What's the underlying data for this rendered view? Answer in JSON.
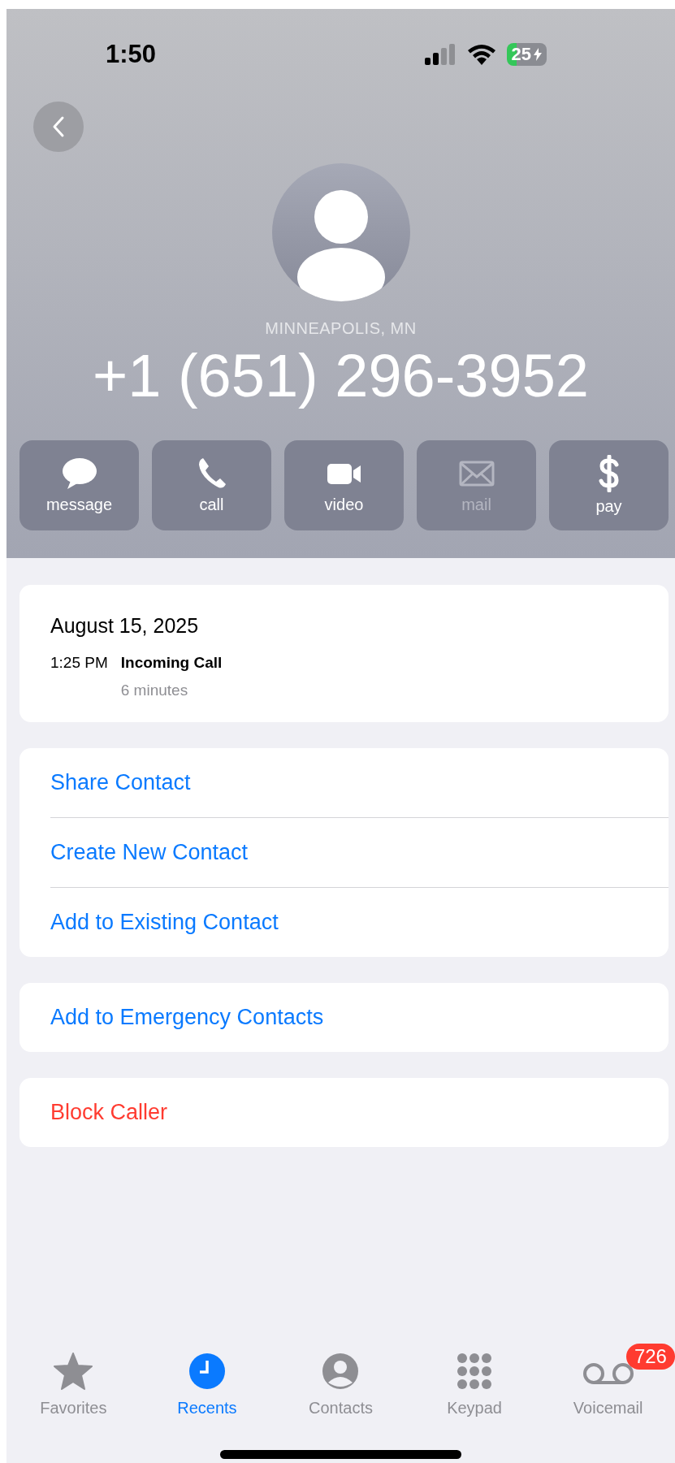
{
  "status_bar": {
    "time": "1:50",
    "battery": "25"
  },
  "header": {
    "location": "MINNEAPOLIS, MN",
    "number": "+1 (651) 296-3952"
  },
  "actions": [
    {
      "label": "message",
      "kind": "message",
      "disabled": false
    },
    {
      "label": "call",
      "kind": "call",
      "disabled": false
    },
    {
      "label": "video",
      "kind": "video",
      "disabled": false
    },
    {
      "label": "mail",
      "kind": "mail",
      "disabled": true
    },
    {
      "label": "pay",
      "kind": "pay",
      "disabled": false
    }
  ],
  "call_log": {
    "date": "August 15, 2025",
    "entries": [
      {
        "time": "1:25 PM",
        "type": "Incoming Call",
        "duration": "6 minutes"
      }
    ]
  },
  "groups": [
    {
      "items": [
        {
          "label": "Share Contact",
          "kind": "normal"
        },
        {
          "label": "Create New Contact",
          "kind": "normal"
        },
        {
          "label": "Add to Existing Contact",
          "kind": "normal"
        }
      ]
    },
    {
      "items": [
        {
          "label": "Add to Emergency Contacts",
          "kind": "normal"
        }
      ]
    },
    {
      "items": [
        {
          "label": "Block Caller",
          "kind": "destructive"
        }
      ]
    }
  ],
  "tabs": [
    {
      "label": "Favorites",
      "kind": "favorites",
      "selected": false
    },
    {
      "label": "Recents",
      "kind": "recents",
      "selected": true
    },
    {
      "label": "Contacts",
      "kind": "contacts",
      "selected": false
    },
    {
      "label": "Keypad",
      "kind": "keypad",
      "selected": false
    },
    {
      "label": "Voicemail",
      "kind": "voicemail",
      "selected": false,
      "badge": "726"
    }
  ]
}
